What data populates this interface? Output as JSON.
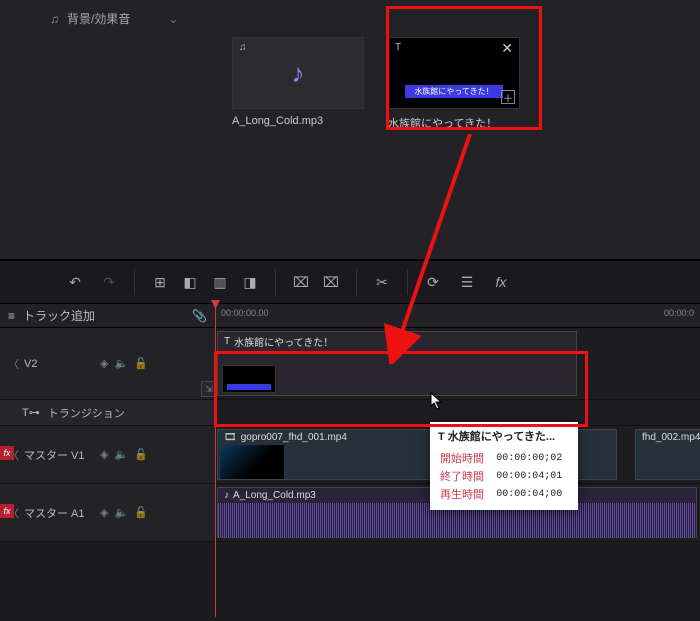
{
  "sidebar": {
    "bg_effects_label": "背景/効果音"
  },
  "assets": {
    "audio": {
      "caption": "A_Long_Cold.mp3",
      "type_tag": "♫"
    },
    "title": {
      "type_tag": "T",
      "banner": "水族館にやってきた！",
      "caption": "水族館にやってきた！"
    }
  },
  "timeline": {
    "add_track_label": "トラック追加",
    "timecodes": {
      "t0": "00:00:00.00",
      "t1": "00:00:0"
    },
    "tracks": {
      "v2": {
        "name": "V2"
      },
      "transition": {
        "label": "トランジション"
      },
      "v1": {
        "name": "マスター V1"
      },
      "a1": {
        "name": "マスター A1"
      }
    },
    "clips": {
      "title": {
        "label": "水族館にやってきた！"
      },
      "video1": {
        "label": "gopro007_fhd_001.mp4"
      },
      "video2": {
        "label": "fhd_002.mp4"
      },
      "audio": {
        "label": "A_Long_Cold.mp3"
      }
    }
  },
  "tooltip": {
    "title": "T 水族館にやってきた...",
    "start_key": "開始時間",
    "start_val": "00:00:00;02",
    "end_key": "終了時間",
    "end_val": "00:00:04;01",
    "dur_key": "再生時間",
    "dur_val": "00:00:04;00"
  },
  "icons": {
    "note": "♫",
    "text": "T",
    "eye": "👁",
    "mute": "🔈",
    "lock": "🔒",
    "link": "🔗",
    "fx": "fx",
    "movie": "🎞",
    "audio": "♪"
  }
}
